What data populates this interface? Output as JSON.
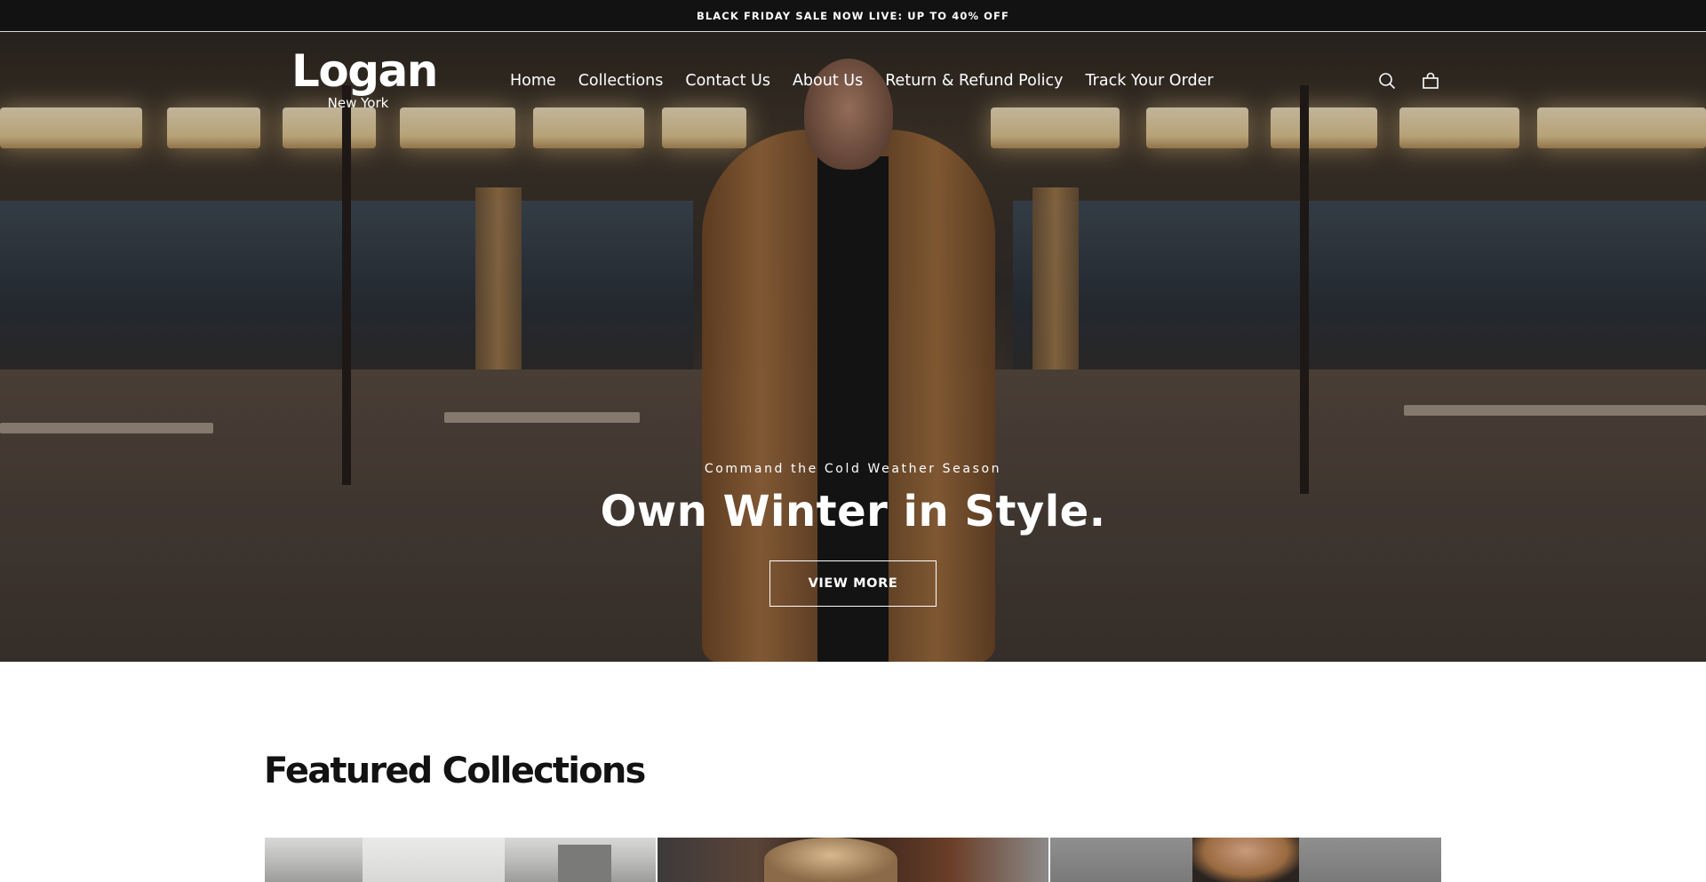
{
  "announcement": {
    "text": "BLACK FRIDAY SALE NOW LIVE: UP TO 40% OFF"
  },
  "header": {
    "logo_brand": "Logan",
    "logo_city": "New York",
    "nav": [
      {
        "label": "Home"
      },
      {
        "label": "Collections"
      },
      {
        "label": "Contact Us"
      },
      {
        "label": "About Us"
      },
      {
        "label": "Return & Refund Policy"
      },
      {
        "label": "Track Your Order"
      }
    ],
    "icons": {
      "search": "search-icon",
      "cart": "shopping-bag-icon"
    }
  },
  "hero": {
    "eyebrow": "Command the Cold Weather Season",
    "headline": "Own Winter in Style.",
    "cta_label": "VIEW MORE"
  },
  "featured": {
    "title": "Featured Collections"
  },
  "colors": {
    "announcement_bg": "#121212",
    "text_light": "#ffffff",
    "text_dark": "#121212"
  }
}
